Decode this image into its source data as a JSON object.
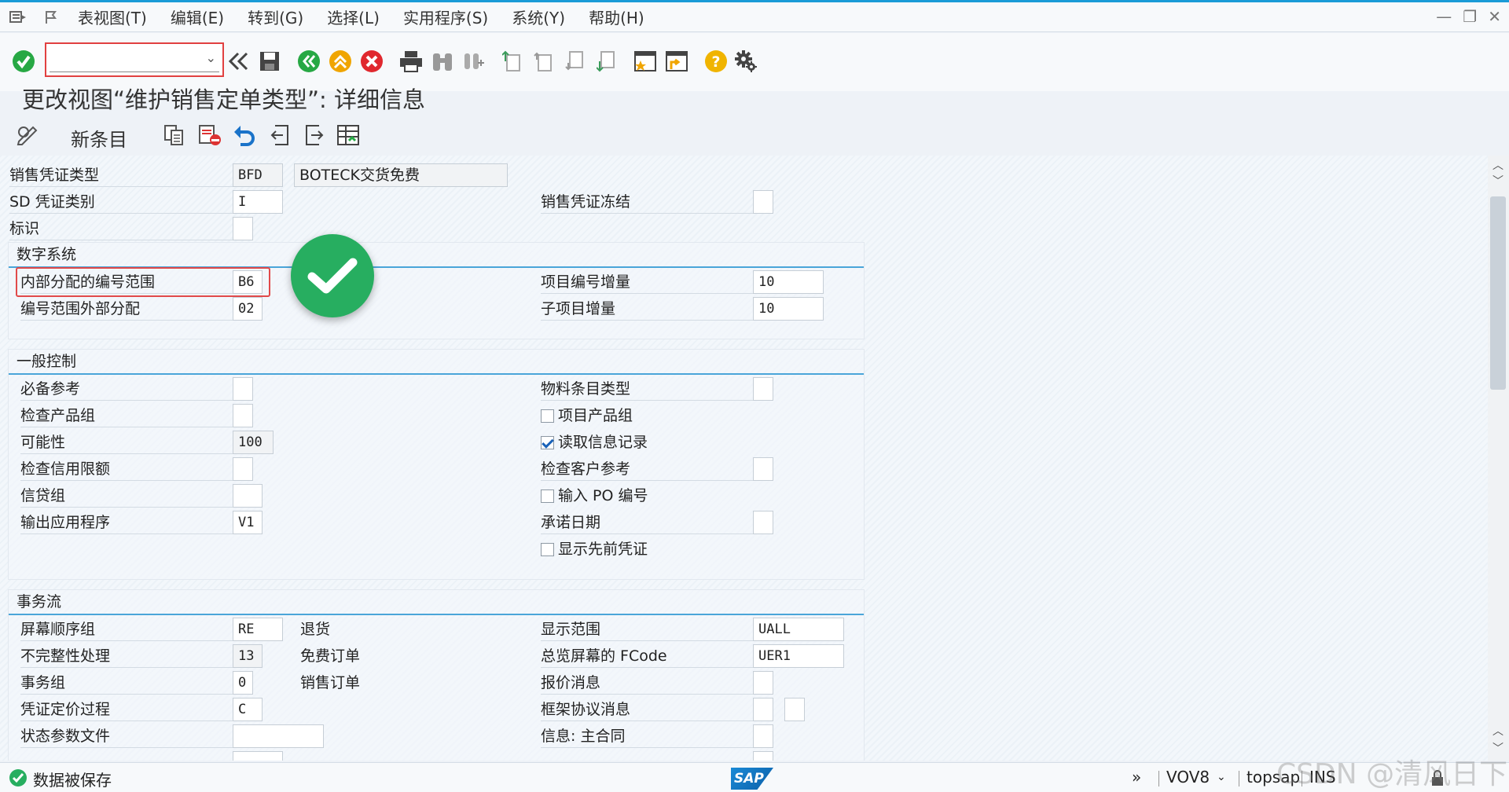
{
  "menu": {
    "items": [
      "表视图(T)",
      "编辑(E)",
      "转到(G)",
      "选择(L)",
      "实用程序(S)",
      "系统(Y)",
      "帮助(H)"
    ]
  },
  "window_controls": [
    "—",
    "❐",
    "✕"
  ],
  "toolbar": {
    "command_field": ""
  },
  "page_title": "更改视图“维护销售定单类型”: 详细信息",
  "app_toolbar": {
    "new_entry": "新条目"
  },
  "header": {
    "doc_type_label": "销售凭证类型",
    "doc_type_value": "BFD",
    "doc_type_desc": "BOTECK交货免费",
    "sd_cat_label": "SD 凭证类别",
    "sd_cat_value": "I",
    "block_label": "销售凭证冻结",
    "indicator_label": "标识"
  },
  "numbering": {
    "title": "数字系统",
    "internal_label": "内部分配的编号范围",
    "internal_value": "B6",
    "external_label": "编号范围外部分配",
    "external_value": "02",
    "item_incr_label": "项目编号增量",
    "item_incr_value": "10",
    "sub_incr_label": "子项目增量",
    "sub_incr_value": "10"
  },
  "general": {
    "title": "一般控制",
    "ref_mand_label": "必备参考",
    "check_div_label": "检查产品组",
    "probability_label": "可能性",
    "probability_value": "100",
    "check_credit_label": "检查信用限额",
    "credit_group_label": "信贷组",
    "output_app_label": "输出应用程序",
    "output_app_value": "V1",
    "mat_entry_label": "物料条目类型",
    "item_div_label": "项目产品组",
    "read_info_label": "读取信息记录",
    "check_cust_ref_label": "检查客户参考",
    "enter_po_label": "输入 PO 编号",
    "commit_date_label": "承诺日期",
    "display_prev_label": "显示先前凭证"
  },
  "flow": {
    "title": "事务流",
    "screen_seq_label": "屏幕顺序组",
    "screen_seq_value": "RE",
    "screen_seq_desc": "退货",
    "incomp_label": "不完整性处理",
    "incomp_value": "13",
    "incomp_desc": "免费订单",
    "trans_group_label": "事务组",
    "trans_group_value": "0",
    "trans_group_desc": "销售订单",
    "pricing_label": "凭证定价过程",
    "pricing_value": "C",
    "status_profile_label": "状态参数文件",
    "display_range_label": "显示范围",
    "display_range_value": "UALL",
    "fcode_label": "总览屏幕的 FCode",
    "fcode_value": "UER1",
    "quot_msg_label": "报价消息",
    "outline_msg_label": "框架协议消息",
    "master_contract_label": "信息: 主合同"
  },
  "status": {
    "message": "数据被保存",
    "transaction": "VOV8",
    "server": "topsap",
    "mode": "INS",
    "watermark": "CSDN @清风日下"
  }
}
